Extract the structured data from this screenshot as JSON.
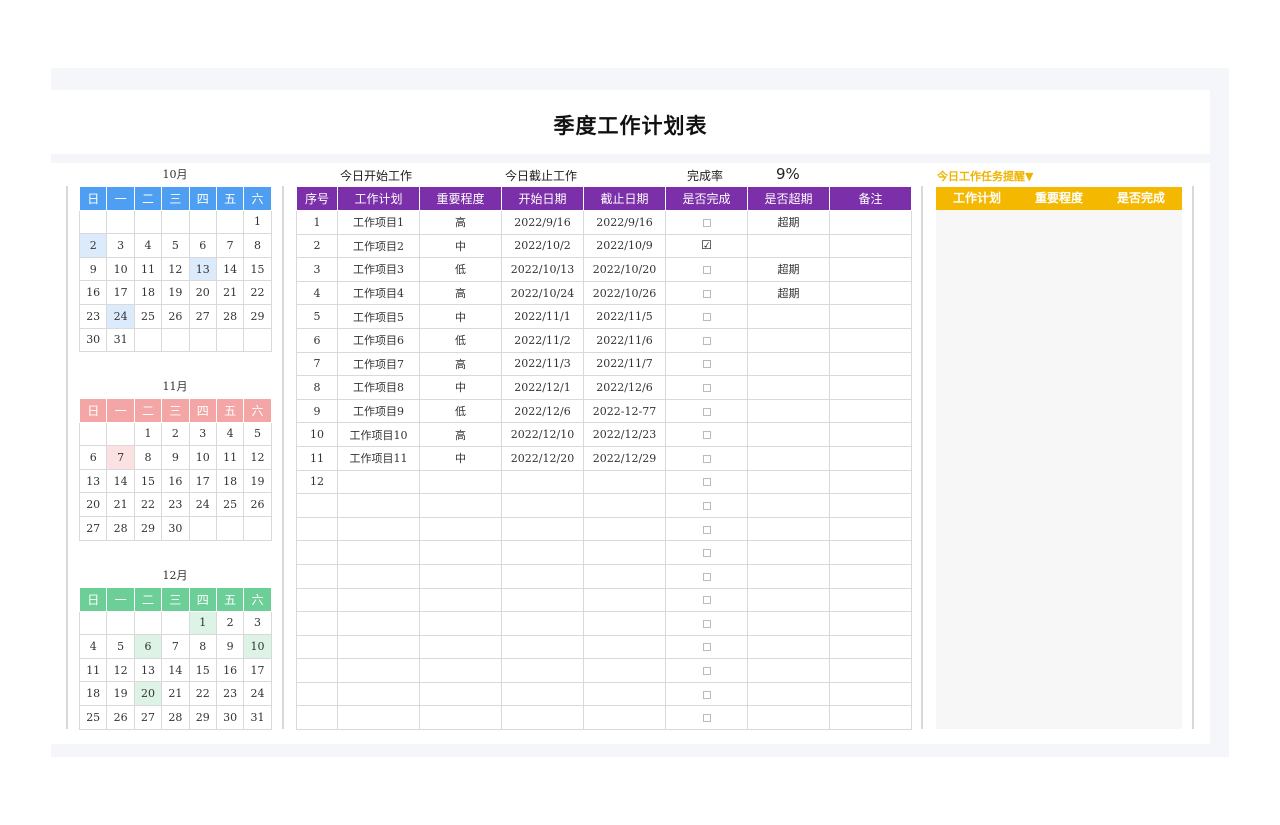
{
  "title": "季度工作计划表",
  "info": {
    "today_start_label": "今日开始工作",
    "today_due_label": "今日截止工作",
    "completion_label": "完成率",
    "completion_value": "9%"
  },
  "calendars": [
    {
      "month": "10月",
      "theme": "blue",
      "weekdays": [
        "日",
        "一",
        "二",
        "三",
        "四",
        "五",
        "六"
      ],
      "weeks": [
        [
          "",
          "",
          "",
          "",
          "",
          "",
          "1"
        ],
        [
          "2",
          "3",
          "4",
          "5",
          "6",
          "7",
          "8"
        ],
        [
          "9",
          "10",
          "11",
          "12",
          "13",
          "14",
          "15"
        ],
        [
          "16",
          "17",
          "18",
          "19",
          "20",
          "21",
          "22"
        ],
        [
          "23",
          "24",
          "25",
          "26",
          "27",
          "28",
          "29"
        ],
        [
          "30",
          "31",
          "",
          "",
          "",
          "",
          ""
        ]
      ],
      "highlights": [
        "2",
        "13",
        "24"
      ]
    },
    {
      "month": "11月",
      "theme": "pink",
      "weekdays": [
        "日",
        "一",
        "二",
        "三",
        "四",
        "五",
        "六"
      ],
      "weeks": [
        [
          "",
          "",
          "1",
          "2",
          "3",
          "4",
          "5"
        ],
        [
          "6",
          "7",
          "8",
          "9",
          "10",
          "11",
          "12"
        ],
        [
          "13",
          "14",
          "15",
          "16",
          "17",
          "18",
          "19"
        ],
        [
          "20",
          "21",
          "22",
          "23",
          "24",
          "25",
          "26"
        ],
        [
          "27",
          "28",
          "29",
          "30",
          "",
          "",
          ""
        ]
      ],
      "highlights": [
        "7"
      ]
    },
    {
      "month": "12月",
      "theme": "green",
      "weekdays": [
        "日",
        "一",
        "二",
        "三",
        "四",
        "五",
        "六"
      ],
      "weeks": [
        [
          "",
          "",
          "",
          "",
          "1",
          "2",
          "3"
        ],
        [
          "4",
          "5",
          "6",
          "7",
          "8",
          "9",
          "10"
        ],
        [
          "11",
          "12",
          "13",
          "14",
          "15",
          "16",
          "17"
        ],
        [
          "18",
          "19",
          "20",
          "21",
          "22",
          "23",
          "24"
        ],
        [
          "25",
          "26",
          "27",
          "28",
          "29",
          "30",
          "31"
        ]
      ],
      "highlights": [
        "1",
        "6",
        "10",
        "20"
      ]
    }
  ],
  "plan_table": {
    "columns": [
      "序号",
      "工作计划",
      "重要程度",
      "开始日期",
      "截止日期",
      "是否完成",
      "是否超期",
      "备注"
    ],
    "rows": [
      {
        "no": "1",
        "task": "工作项目1",
        "priority": "高",
        "start": "2022/9/16",
        "due": "2022/9/16",
        "done": false,
        "overdue": "超期",
        "note": ""
      },
      {
        "no": "2",
        "task": "工作项目2",
        "priority": "中",
        "start": "2022/10/2",
        "due": "2022/10/9",
        "done": true,
        "overdue": "",
        "note": ""
      },
      {
        "no": "3",
        "task": "工作项目3",
        "priority": "低",
        "start": "2022/10/13",
        "due": "2022/10/20",
        "done": false,
        "overdue": "超期",
        "note": ""
      },
      {
        "no": "4",
        "task": "工作项目4",
        "priority": "高",
        "start": "2022/10/24",
        "due": "2022/10/26",
        "done": false,
        "overdue": "超期",
        "note": ""
      },
      {
        "no": "5",
        "task": "工作项目5",
        "priority": "中",
        "start": "2022/11/1",
        "due": "2022/11/5",
        "done": false,
        "overdue": "",
        "note": ""
      },
      {
        "no": "6",
        "task": "工作项目6",
        "priority": "低",
        "start": "2022/11/2",
        "due": "2022/11/6",
        "done": false,
        "overdue": "",
        "note": ""
      },
      {
        "no": "7",
        "task": "工作项目7",
        "priority": "高",
        "start": "2022/11/3",
        "due": "2022/11/7",
        "done": false,
        "overdue": "",
        "note": ""
      },
      {
        "no": "8",
        "task": "工作项目8",
        "priority": "中",
        "start": "2022/12/1",
        "due": "2022/12/6",
        "done": false,
        "overdue": "",
        "note": ""
      },
      {
        "no": "9",
        "task": "工作项目9",
        "priority": "低",
        "start": "2022/12/6",
        "due": "2022-12-77",
        "done": false,
        "overdue": "",
        "note": ""
      },
      {
        "no": "10",
        "task": "工作项目10",
        "priority": "高",
        "start": "2022/12/10",
        "due": "2022/12/23",
        "done": false,
        "overdue": "",
        "note": ""
      },
      {
        "no": "11",
        "task": "工作项目11",
        "priority": "中",
        "start": "2022/12/20",
        "due": "2022/12/29",
        "done": false,
        "overdue": "",
        "note": ""
      },
      {
        "no": "12",
        "task": "",
        "priority": "",
        "start": "",
        "due": "",
        "done": false,
        "overdue": "",
        "note": ""
      },
      {
        "no": "",
        "task": "",
        "priority": "",
        "start": "",
        "due": "",
        "done": false,
        "overdue": "",
        "note": ""
      },
      {
        "no": "",
        "task": "",
        "priority": "",
        "start": "",
        "due": "",
        "done": false,
        "overdue": "",
        "note": ""
      },
      {
        "no": "",
        "task": "",
        "priority": "",
        "start": "",
        "due": "",
        "done": false,
        "overdue": "",
        "note": ""
      },
      {
        "no": "",
        "task": "",
        "priority": "",
        "start": "",
        "due": "",
        "done": false,
        "overdue": "",
        "note": ""
      },
      {
        "no": "",
        "task": "",
        "priority": "",
        "start": "",
        "due": "",
        "done": false,
        "overdue": "",
        "note": ""
      },
      {
        "no": "",
        "task": "",
        "priority": "",
        "start": "",
        "due": "",
        "done": false,
        "overdue": "",
        "note": ""
      },
      {
        "no": "",
        "task": "",
        "priority": "",
        "start": "",
        "due": "",
        "done": false,
        "overdue": "",
        "note": ""
      },
      {
        "no": "",
        "task": "",
        "priority": "",
        "start": "",
        "due": "",
        "done": false,
        "overdue": "",
        "note": ""
      },
      {
        "no": "",
        "task": "",
        "priority": "",
        "start": "",
        "due": "",
        "done": false,
        "overdue": "",
        "note": ""
      },
      {
        "no": "",
        "task": "",
        "priority": "",
        "start": "",
        "due": "",
        "done": false,
        "overdue": "",
        "note": ""
      }
    ]
  },
  "reminder": {
    "title": "今日工作任务提醒▼",
    "columns": [
      "工作计划",
      "重要程度",
      "是否完成"
    ]
  },
  "colors": {
    "plan_header": "#7b2fa8",
    "reminder_header": "#f5b800",
    "oct_header": "#4e9ef2",
    "nov_header": "#f4a6a6",
    "dec_header": "#6ccf98"
  }
}
